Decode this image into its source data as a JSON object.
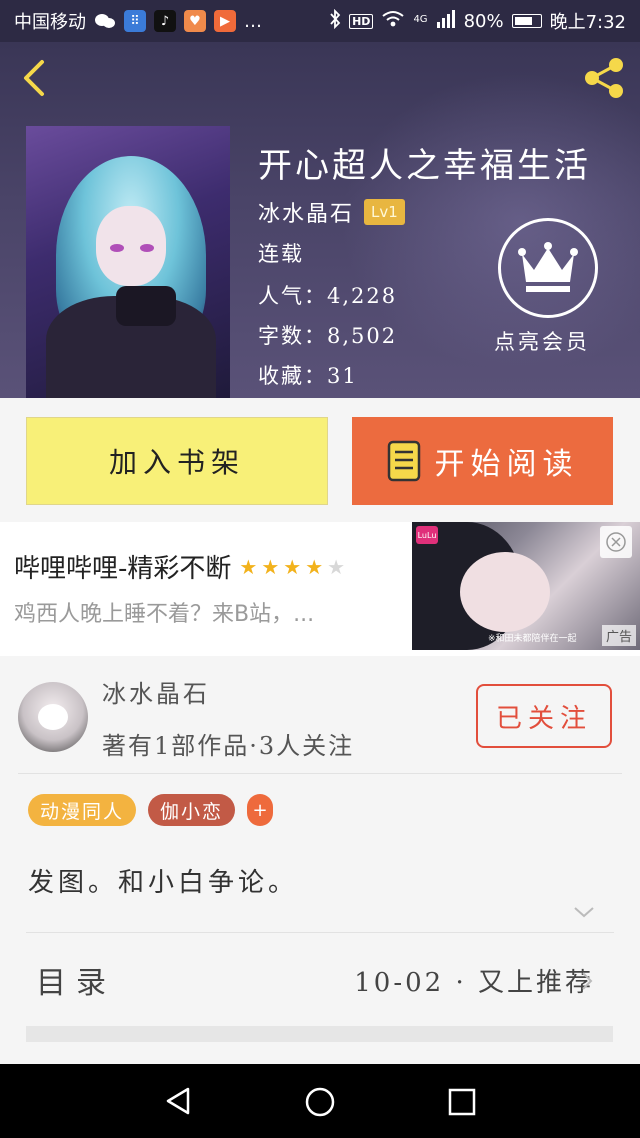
{
  "status_bar": {
    "carrier": "中国移动",
    "network": "4G",
    "hd": "HD",
    "battery": "80%",
    "battery_level": 0.8,
    "time": "晚上7:32",
    "more": "…"
  },
  "book": {
    "title": "开心超人之幸福生活",
    "author": "冰水晶石",
    "level": "Lv1",
    "status": "连载",
    "popularity_label": "人气：",
    "popularity": "4,228",
    "words_label": "字数：",
    "words": "8,502",
    "favorites_label": "收藏：",
    "favorites": "31"
  },
  "vip": {
    "label": "点亮会员",
    "icon": "crown-icon"
  },
  "actions": {
    "add_shelf": "加入书架",
    "start_reading": "开始阅读"
  },
  "ad": {
    "title": "哔哩哔哩-精彩不断",
    "rating": 4,
    "rating_max": 5,
    "subtitle": "鸡西人晚上睡不着？来B站，...",
    "badge": "广告",
    "logo": "LuLu",
    "caption": "※和田未都陪伴在一起"
  },
  "author_section": {
    "name": "冰水晶石",
    "meta": "著有1部作品·3人关注",
    "follow": "已关注",
    "tags": [
      {
        "label": "动漫同人",
        "color": "#f3b340"
      },
      {
        "label": "伽小恋",
        "color": "#c25a46"
      }
    ],
    "tag_plus": "+",
    "description": "发图。和小白争论。"
  },
  "toc": {
    "label": "目录",
    "meta": "10-02 · 又上推荐"
  },
  "colors": {
    "header_bg": "#3a3656",
    "shelf_btn": "#f8f078",
    "read_btn": "#ec6b3f",
    "follow": "#e24e3c",
    "level_badge": "#e8b640",
    "star": "#f2b21c"
  }
}
